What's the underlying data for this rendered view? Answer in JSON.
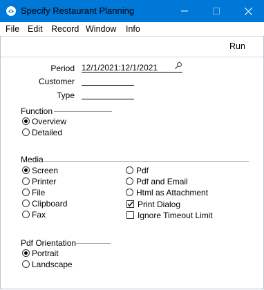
{
  "window": {
    "title": "Specify Restaurant Planning",
    "minimize_icon": "minimize-icon",
    "maximize_icon": "maximize-icon",
    "close_icon": "close-icon"
  },
  "menu": [
    "File",
    "Edit",
    "Record",
    "Window",
    "Info"
  ],
  "toolbar": {
    "run_label": "Run"
  },
  "fields": {
    "period": {
      "label": "Period",
      "value": "12/1/2021:12/1/2021",
      "icon": "paste-special-icon"
    },
    "customer": {
      "label": "Customer",
      "value": ""
    },
    "type": {
      "label": "Type",
      "value": ""
    }
  },
  "function": {
    "title": "Function",
    "options": [
      "Overview",
      "Detailed"
    ],
    "selected": "Overview"
  },
  "media": {
    "title": "Media",
    "left": [
      "Screen",
      "Printer",
      "File",
      "Clipboard",
      "Fax"
    ],
    "right": [
      "Pdf",
      "Pdf and Email",
      "Html as Attachment"
    ],
    "selected": "Screen",
    "checkboxes": [
      {
        "label": "Print Dialog",
        "checked": true
      },
      {
        "label": "Ignore Timeout Limit",
        "checked": false
      }
    ]
  },
  "orientation": {
    "title": "Pdf Orientation",
    "options": [
      "Portrait",
      "Landscape"
    ],
    "selected": "Portrait"
  }
}
